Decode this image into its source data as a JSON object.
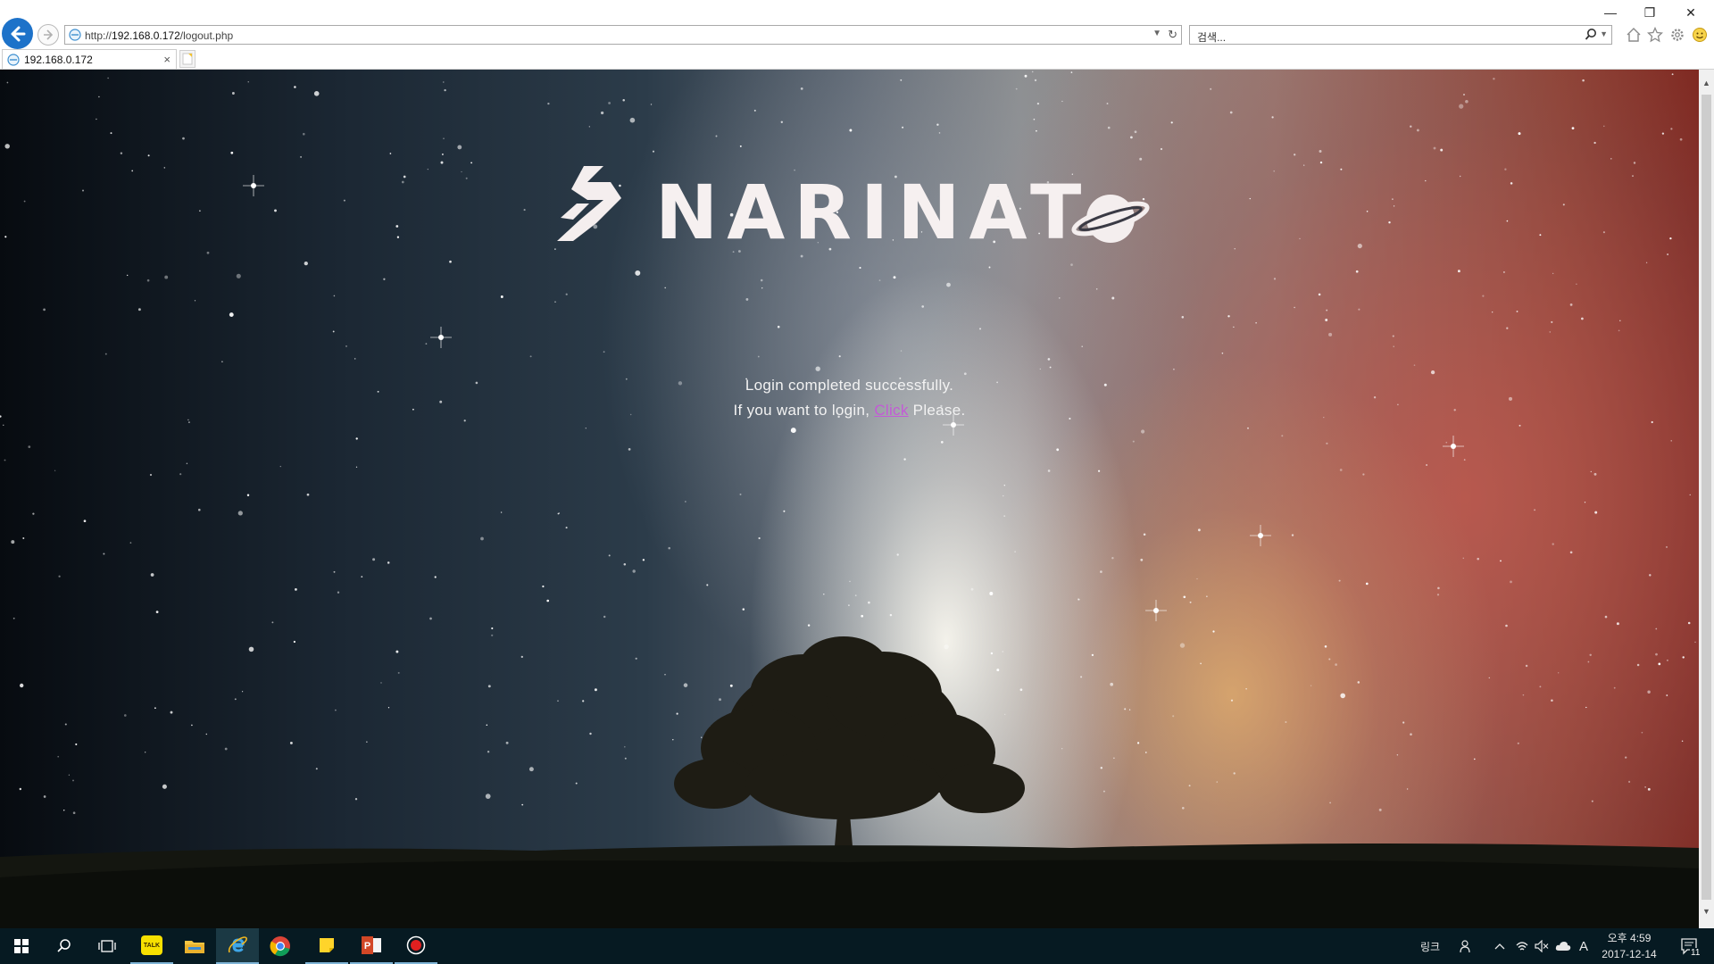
{
  "browser": {
    "url_prefix": "http://",
    "url_host": "192.168.0.172",
    "url_path": "/logout.php",
    "search_placeholder": "검색...",
    "tab_title": "192.168.0.172"
  },
  "page": {
    "logo_text": "NARINAT",
    "message_line1": "Login completed successfully.",
    "message_line2_prefix": "If you want to login, ",
    "login_link": "Click",
    "message_line2_suffix": " Please.",
    "link_color": "#c35ad6"
  },
  "taskbar": {
    "pinned_apps": [
      "start-icon",
      "search-icon",
      "task-view-icon",
      "kakaotalk-icon",
      "file-explorer-icon",
      "internet-explorer-icon",
      "chrome-icon",
      "sticky-notes-icon",
      "powerpoint-icon",
      "record-icon"
    ],
    "kakaotalk_label": "TALK",
    "links_label": "링크",
    "ime_label": "A",
    "time": "오후 4:59",
    "date": "2017-12-14",
    "notification_count": "11"
  },
  "colors": {
    "accent_back_button": "#1d72c9",
    "taskbar_bg": "#061a22"
  }
}
